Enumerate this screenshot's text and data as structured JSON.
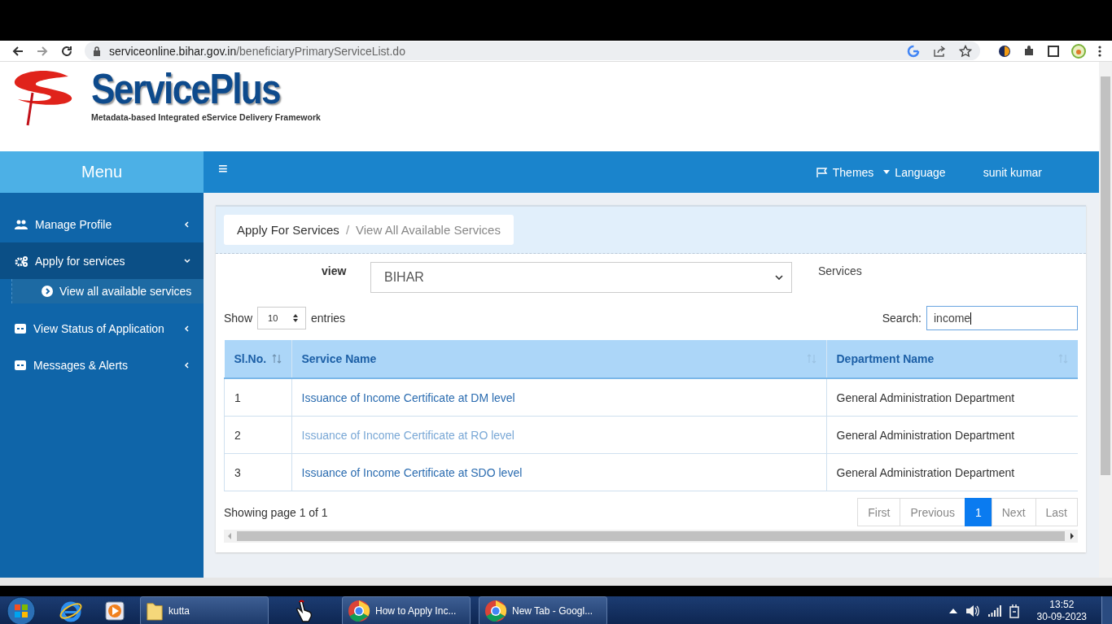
{
  "browser": {
    "url_host": "serviceonline.bihar.gov.in",
    "url_path": "/beneficiaryPrimaryServiceList.do"
  },
  "header": {
    "brand": "ServicePlus",
    "tagline": "Metadata-based Integrated eService Delivery Framework"
  },
  "topbar": {
    "menu_title": "Menu",
    "menu_toggle": "≡",
    "links": [
      "Themes",
      "Language",
      "sunit kumar"
    ]
  },
  "sidebar": {
    "items": [
      {
        "label": "Manage Profile",
        "expanded": false,
        "selected": false
      },
      {
        "label": "Apply for services",
        "expanded": true,
        "selected": true,
        "children": [
          {
            "label": "View all available services",
            "selected": true
          }
        ]
      },
      {
        "label": "View Status of Application",
        "expanded": false,
        "selected": false
      },
      {
        "label": "Messages & Alerts",
        "expanded": false,
        "selected": false
      }
    ]
  },
  "breadcrumb": [
    "Apply For Services",
    "View All Available Services"
  ],
  "breadcrumb_separator": "/",
  "filter": {
    "label": "view",
    "value": "BIHAR",
    "right_label": "Services"
  },
  "table_controls": {
    "show_label": "Show",
    "page_size": "10",
    "entries_label": "entries",
    "search_label": "Search:",
    "search_value": "income"
  },
  "table": {
    "columns": [
      "Sl.No.",
      "Service Name",
      "Department Name"
    ],
    "rows": [
      {
        "no": "1",
        "service": "Issuance of Income Certificate at DM level",
        "department": "General Administration Department",
        "hovered": false
      },
      {
        "no": "2",
        "service": "Issuance of Income Certificate at RO level",
        "department": "General Administration Department",
        "hovered": true
      },
      {
        "no": "3",
        "service": "Issuance of Income Certificate at SDO level",
        "department": "General Administration Department",
        "hovered": false
      }
    ]
  },
  "footer": {
    "info": "Showing page 1 of 1",
    "pages": [
      {
        "label": "First",
        "selected": false
      },
      {
        "label": "Previous",
        "selected": false
      },
      {
        "label": "1",
        "selected": true
      },
      {
        "label": "Next",
        "selected": false
      },
      {
        "label": "Last",
        "selected": false
      }
    ]
  },
  "taskbar": {
    "tasks": [
      {
        "label": "kutta",
        "kind": "folder"
      },
      {
        "label": "How to Apply Inc...",
        "kind": "chrome"
      },
      {
        "label": "New Tab - Googl...",
        "kind": "chrome"
      }
    ],
    "time": "13:52",
    "date": "30-09-2023"
  }
}
